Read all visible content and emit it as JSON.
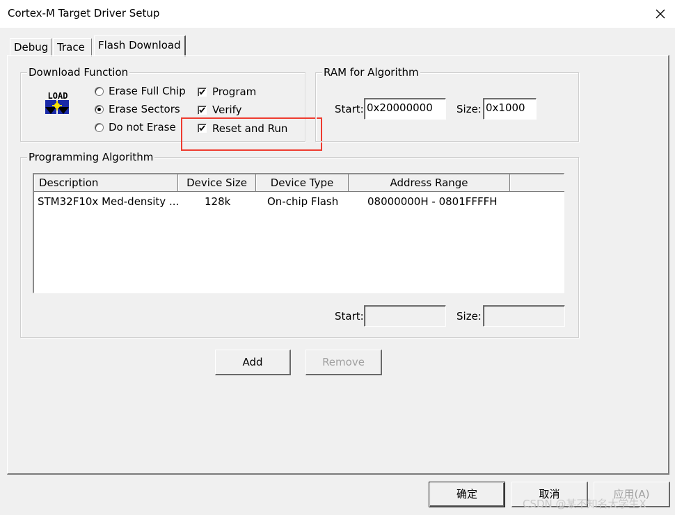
{
  "window": {
    "title": "Cortex-M Target Driver Setup",
    "close_icon": "close-icon"
  },
  "tabs": [
    {
      "label": "Debug",
      "active": false
    },
    {
      "label": "Trace",
      "active": false
    },
    {
      "label": "Flash Download",
      "active": true
    }
  ],
  "download_function": {
    "title": "Download Function",
    "icon_text": "LOAD",
    "radios": [
      {
        "label": "Erase Full Chip",
        "checked": false
      },
      {
        "label": "Erase Sectors",
        "checked": true
      },
      {
        "label": "Do not Erase",
        "checked": false
      }
    ],
    "checkboxes": [
      {
        "label": "Program",
        "checked": true
      },
      {
        "label": "Verify",
        "checked": true
      },
      {
        "label": "Reset and Run",
        "checked": true
      }
    ]
  },
  "ram_for_algorithm": {
    "title": "RAM for Algorithm",
    "start_label": "Start:",
    "start_value": "0x20000000",
    "size_label": "Size:",
    "size_value": "0x1000"
  },
  "programming_algorithm": {
    "title": "Programming Algorithm",
    "columns": [
      "Description",
      "Device Size",
      "Device Type",
      "Address Range"
    ],
    "rows": [
      [
        "STM32F10x Med-density ...",
        "128k",
        "On-chip Flash",
        "08000000H - 0801FFFFH"
      ]
    ],
    "start_label": "Start:",
    "start_value": "",
    "size_label": "Size:",
    "size_value": ""
  },
  "buttons": {
    "add": "Add",
    "remove": "Remove",
    "ok": "确定",
    "cancel": "取消",
    "apply": "应用(A)"
  },
  "watermark": "CSDN @某不知名大学生X",
  "colors": {
    "highlight": "#ee3b2f",
    "background": "#f0f0f0"
  }
}
